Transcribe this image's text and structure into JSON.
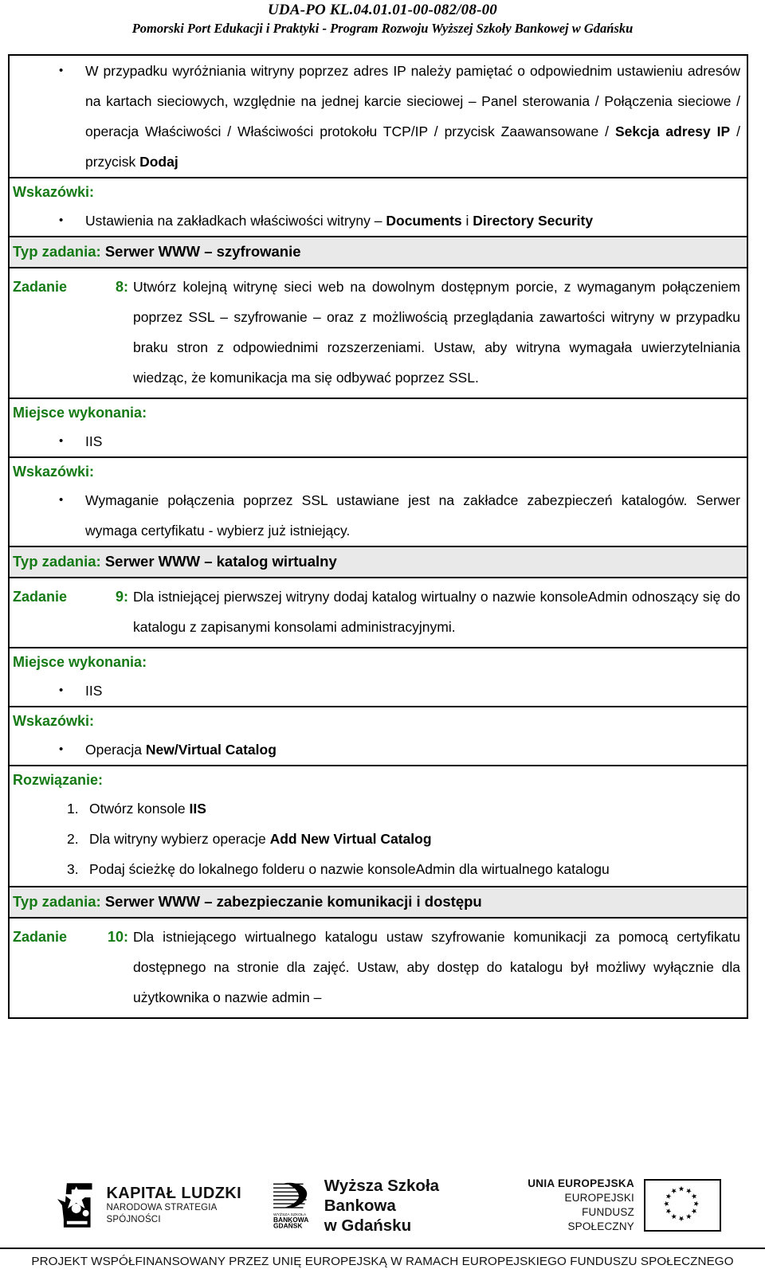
{
  "header": {
    "project_code": "UDA-PO KL.04.01.01-00-082/08-00",
    "project_title": "Pomorski Port Edukacji i Praktyki - Program Rozwoju Wyższej Szkoły Bankowej w Gdańsku"
  },
  "labels": {
    "wskazowki": "Wskazówki:",
    "miejsce": "Miejsce wykonania:",
    "rozwiazanie": "Rozwiązanie:",
    "typ_zadania": "Typ zadania:"
  },
  "sections": {
    "tip_ip": {
      "line_a": "W przypadku wyróżniania witryny poprzez adres IP należy pamiętać o odpowiednim ustawieniu adresów na kartach sieciowych, względnie na jednej karcie sieciowej – Panel sterowania / Połączenia sieciowe / operacja Właściwości / Właściwości protokołu TCP/IP / przycisk Zaawansowane / ",
      "bold_a": "Sekcja adresy IP",
      "line_b": " / przycisk ",
      "bold_b": "Dodaj"
    },
    "hint_tabs": {
      "pre": "Ustawienia na zakładkach właściwości witryny – ",
      "bold1": "Documents",
      "mid": " i ",
      "bold2": "Directory Security"
    },
    "typ8": {
      "label": "Typ zadania:",
      "value": "Serwer WWW – szyfrowanie"
    },
    "zadanie8": {
      "tag": "Zadanie 8:",
      "text": "Utwórz kolejną witrynę sieci web na dowolnym dostępnym porcie, z wymaganym połączeniem poprzez SSL – szyfrowanie – oraz z możliwością przeglądania zawartości witryny w przypadku braku stron z odpowiednimi rozszerzeniami. Ustaw, aby witryna wymagała uwierzytelniania wiedząc, że komunikacja ma się odbywać poprzez SSL."
    },
    "miejsce8": {
      "item": "IIS"
    },
    "wskazowki8": {
      "text": "Wymaganie połączenia poprzez SSL ustawiane jest na zakładce zabezpieczeń katalogów. Serwer wymaga certyfikatu - wybierz już istniejący."
    },
    "typ9": {
      "label": "Typ zadania:",
      "value": "Serwer WWW – katalog wirtualny"
    },
    "zadanie9": {
      "tag": "Zadanie 9:",
      "text": "Dla istniejącej pierwszej witryny dodaj katalog wirtualny o nazwie konsoleAdmin odnoszący się do katalogu z zapisanymi konsolami administracyjnymi."
    },
    "miejsce9": {
      "item": "IIS"
    },
    "wskazowki9": {
      "pre": "Operacja ",
      "bold": "New/Virtual Catalog"
    },
    "rozwiazanie9": {
      "items": [
        {
          "pre": "Otwórz konsole ",
          "bold": "IIS",
          "post": ""
        },
        {
          "pre": "Dla witryny wybierz operacje ",
          "bold": "Add  New Virtual Catalog",
          "post": ""
        },
        {
          "pre": "Podaj ścieżkę do lokalnego folderu o nazwie konsoleAdmin dla wirtualnego katalogu",
          "bold": "",
          "post": ""
        }
      ]
    },
    "typ10": {
      "label": "Typ zadania:",
      "value": "Serwer WWW – zabezpieczanie komunikacji i dostępu"
    },
    "zadanie10": {
      "tag": "Zadanie 10:",
      "text": "Dla istniejącego wirtualnego katalogu ustaw szyfrowanie komunikacji za pomocą certyfikatu dostępnego na stronie dla zajęć. Ustaw, aby dostęp do katalogu był możliwy wyłącznie dla użytkownika o nazwie admin –"
    }
  },
  "footer": {
    "kapital_ludzki_title": "KAPITAŁ LUDZKI",
    "kapital_ludzki_sub": "NARODOWA STRATEGIA SPÓJNOŚCI",
    "wsb_line1": "Wyższa Szkoła Bankowa",
    "wsb_line2": "w Gdańsku",
    "wsb_mark_l1": "WYŻSZA SZKOŁA",
    "wsb_mark_l2": "BANKOWA",
    "wsb_mark_l3": "GDAŃSK",
    "eu_line1": "UNIA EUROPEJSKA",
    "eu_line2": "EUROPEJSKI",
    "eu_line3": "FUNDUSZ SPOŁECZNY",
    "bottom_note": "PROJEKT WSPÓŁFINANSOWANY PRZEZ UNIĘ EUROPEJSKĄ W RAMACH EUROPEJSKIEGO FUNDUSZU SPOŁECZNEGO"
  },
  "colors": {
    "green": "#157a15",
    "shaded_row": "#e9e9e9",
    "border": "#000000"
  }
}
